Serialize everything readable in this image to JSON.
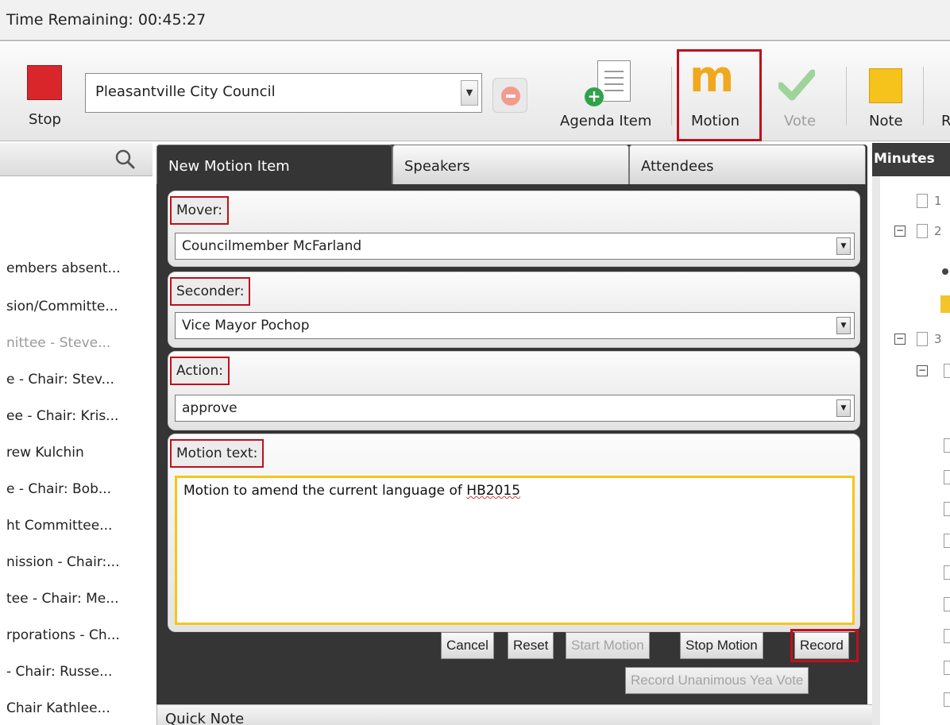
{
  "timebar": {
    "label": "Time Remaining: 00:45:27"
  },
  "toolbar": {
    "stop_label": "Stop",
    "meeting_select": "Pleasantville City Council",
    "agenda_item_label": "Agenda Item",
    "motion_label": "Motion",
    "vote_label": "Vote",
    "note_label": "Note",
    "partial_label": "R"
  },
  "left_list": [
    "embers absent...",
    "sion/Committe...",
    "nittee - Steve...",
    "e - Chair: Stev...",
    "ee - Chair: Kris...",
    "rew Kulchin",
    "e - Chair: Bob...",
    "ht Committee...",
    "nission - Chair:...",
    "tee - Chair: Me...",
    "rporations - Ch...",
    " - Chair: Russe...",
    " Chair Kathlee..."
  ],
  "tabs": [
    "New Motion Item",
    "Speakers",
    "Attendees"
  ],
  "form": {
    "mover_label": "Mover:",
    "mover_value": "Councilmember McFarland",
    "seconder_label": "Seconder:",
    "seconder_value": "Vice Mayor Pochop",
    "action_label": "Action:",
    "action_value": "approve",
    "motion_text_label": "Motion text:",
    "motion_text_value": "Motion to amend the current language of ",
    "motion_text_misspelled": "HB2015"
  },
  "buttons": {
    "cancel": "Cancel",
    "reset": "Reset",
    "start_motion": "Start Motion",
    "stop_motion": "Stop Motion",
    "record": "Record",
    "record_unanimous": "Record Unanimous Yea Vote"
  },
  "quick_note": "Quick Note",
  "minutes": {
    "title": "Minutes",
    "nums": [
      "1",
      "2",
      "3"
    ]
  }
}
